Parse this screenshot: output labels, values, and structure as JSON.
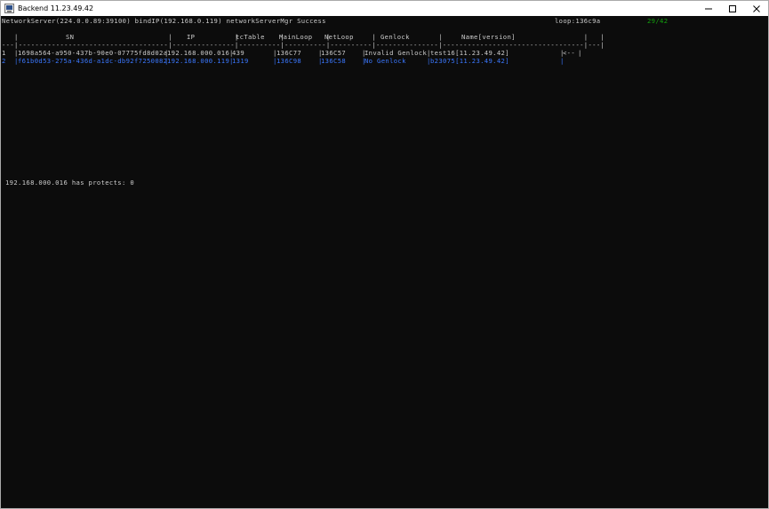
{
  "window": {
    "title": "Backend 11.23.49.42",
    "controls": [
      "minimize-icon",
      "maximize-icon",
      "close-icon"
    ]
  },
  "status": {
    "line": "NetworkServer(224.0.0.89:39100) bindIP(192.168.0.119) networkServerMgr Success",
    "loop": "loop:136c9a",
    "counter": "29/42"
  },
  "table": {
    "header_sep": "   |                                    |               |          |          |          |               |                                  |   |",
    "header": {
      "sn": "SN",
      "ip": "IP",
      "tcTable": "tcTable",
      "mainLoop": "MainLoop",
      "netLoop": "NetLoop",
      "genlock": "Genlock",
      "name": "Name[version]"
    },
    "divider": "---|------------------------------------|---------------|----------|----------|----------|---------------|----------------------------------|---|",
    "rows": [
      {
        "idx": "1",
        "sn": "1698a564-a950-437b-90e0-07775fd8d02a",
        "ip": "192.168.000.016",
        "tcTable": "439",
        "mainLoop": "136C77",
        "netLoop": "136C57",
        "genlock": "Invalid Genlock",
        "name": "test16[11.23.49.42]",
        "marker": "<--",
        "color": "#cccccc"
      },
      {
        "idx": "2",
        "sn": "f61b0d53-275a-436d-a1dc-db92f7250082",
        "ip": "192.168.000.119",
        "tcTable": "1319",
        "mainLoop": "136C98",
        "netLoop": "136C58",
        "genlock": "No Genlock",
        "name": "b23075[11.23.49.42]",
        "marker": "",
        "color": "#3b78ff"
      }
    ]
  },
  "protects": "192.168.000.016 has protects: 0",
  "colors": {
    "background": "#0c0c0c",
    "text": "#cccccc",
    "highlight": "#3b78ff",
    "counter": "#13a10e"
  }
}
